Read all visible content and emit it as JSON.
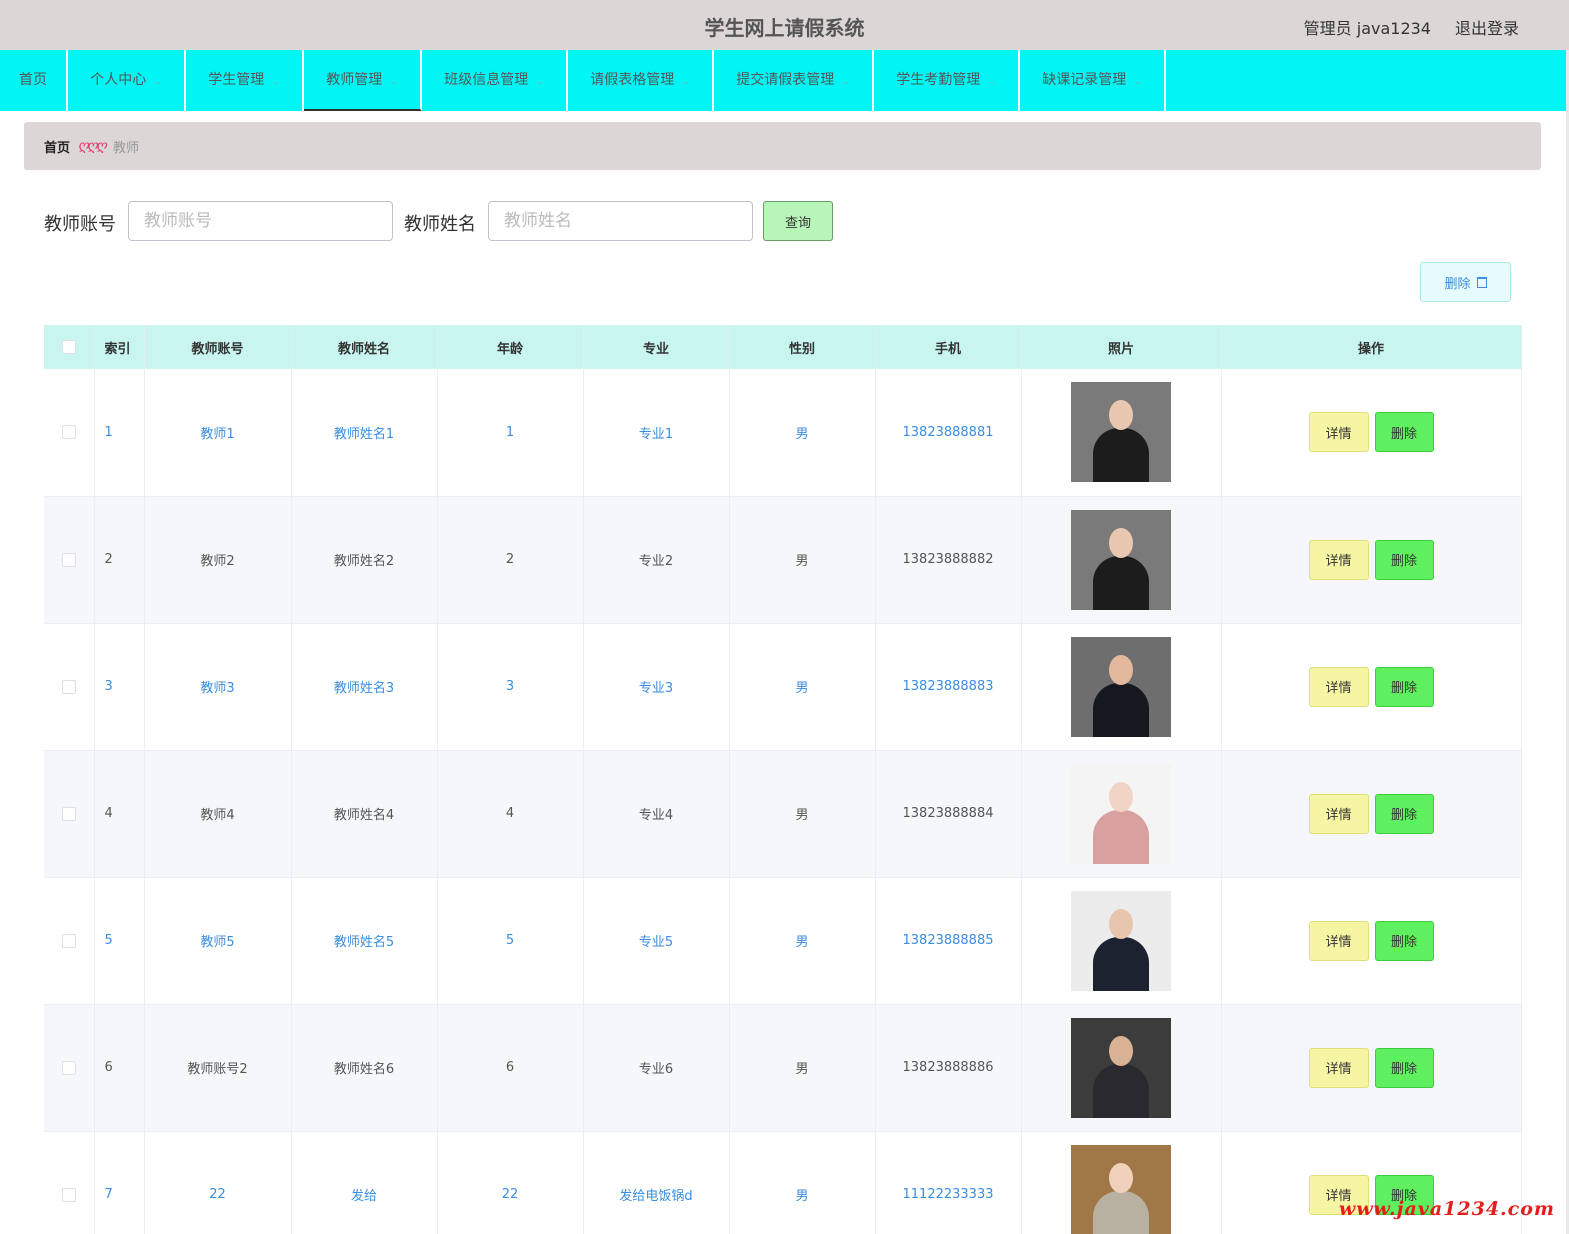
{
  "header": {
    "title": "学生网上请假系统",
    "user": "管理员 java1234",
    "logout": "退出登录"
  },
  "nav": [
    {
      "label": "首页",
      "dropdown": false,
      "width": 68
    },
    {
      "label": "个人中心",
      "dropdown": true,
      "width": 118
    },
    {
      "label": "学生管理",
      "dropdown": true,
      "width": 118
    },
    {
      "label": "教师管理",
      "dropdown": true,
      "width": 118,
      "active": true
    },
    {
      "label": "班级信息管理",
      "dropdown": true,
      "width": 146
    },
    {
      "label": "请假表格管理",
      "dropdown": true,
      "width": 146
    },
    {
      "label": "提交请假表管理",
      "dropdown": true,
      "width": 160
    },
    {
      "label": "学生考勤管理",
      "dropdown": true,
      "width": 146
    },
    {
      "label": "缺课记录管理",
      "dropdown": true,
      "width": 146
    }
  ],
  "breadcrumb": {
    "home": "首页",
    "separator": "ღღღ",
    "current": "教师"
  },
  "search": {
    "account_label": "教师账号",
    "account_placeholder": "教师账号",
    "name_label": "教师姓名",
    "name_placeholder": "教师姓名",
    "query_button": "查询"
  },
  "toolbar": {
    "delete_button": "删除"
  },
  "table": {
    "headers": [
      "索引",
      "教师账号",
      "教师姓名",
      "年龄",
      "专业",
      "性别",
      "手机",
      "照片",
      "操作"
    ],
    "detail_label": "详情",
    "delete_label": "删除",
    "rows": [
      {
        "index": "1",
        "account": "教师1",
        "name": "教师姓名1",
        "age": "1",
        "major": "专业1",
        "gender": "男",
        "phone": "13823888881",
        "photo": {
          "bg": "#7a7a7a",
          "skin": "#e9c7b0",
          "cloth": "#1c1c1c"
        }
      },
      {
        "index": "2",
        "account": "教师2",
        "name": "教师姓名2",
        "age": "2",
        "major": "专业2",
        "gender": "男",
        "phone": "13823888882",
        "photo": {
          "bg": "#7a7a7a",
          "skin": "#e9c7b0",
          "cloth": "#1c1c1c"
        }
      },
      {
        "index": "3",
        "account": "教师3",
        "name": "教师姓名3",
        "age": "3",
        "major": "专业3",
        "gender": "男",
        "phone": "13823888883",
        "photo": {
          "bg": "#6e6e6e",
          "skin": "#e2b99c",
          "cloth": "#161820"
        }
      },
      {
        "index": "4",
        "account": "教师4",
        "name": "教师姓名4",
        "age": "4",
        "major": "专业4",
        "gender": "男",
        "phone": "13823888884",
        "photo": {
          "bg": "#f4f4f4",
          "skin": "#f2d4c4",
          "cloth": "#d9a0a0"
        }
      },
      {
        "index": "5",
        "account": "教师5",
        "name": "教师姓名5",
        "age": "5",
        "major": "专业5",
        "gender": "男",
        "phone": "13823888885",
        "photo": {
          "bg": "#ececec",
          "skin": "#e8c6ae",
          "cloth": "#1d2230"
        }
      },
      {
        "index": "6",
        "account": "教师账号2",
        "name": "教师姓名6",
        "age": "6",
        "major": "专业6",
        "gender": "男",
        "phone": "13823888886",
        "photo": {
          "bg": "#3c3c3c",
          "skin": "#d9b294",
          "cloth": "#2a2a2e"
        }
      },
      {
        "index": "7",
        "account": "22",
        "name": "发给",
        "age": "22",
        "major": "发给电饭锅d",
        "gender": "男",
        "phone": "11122233333",
        "photo": {
          "bg": "#a07848",
          "skin": "#f0d2bc",
          "cloth": "#b8b0a0"
        }
      }
    ]
  },
  "watermark": "www.java1234.com"
}
